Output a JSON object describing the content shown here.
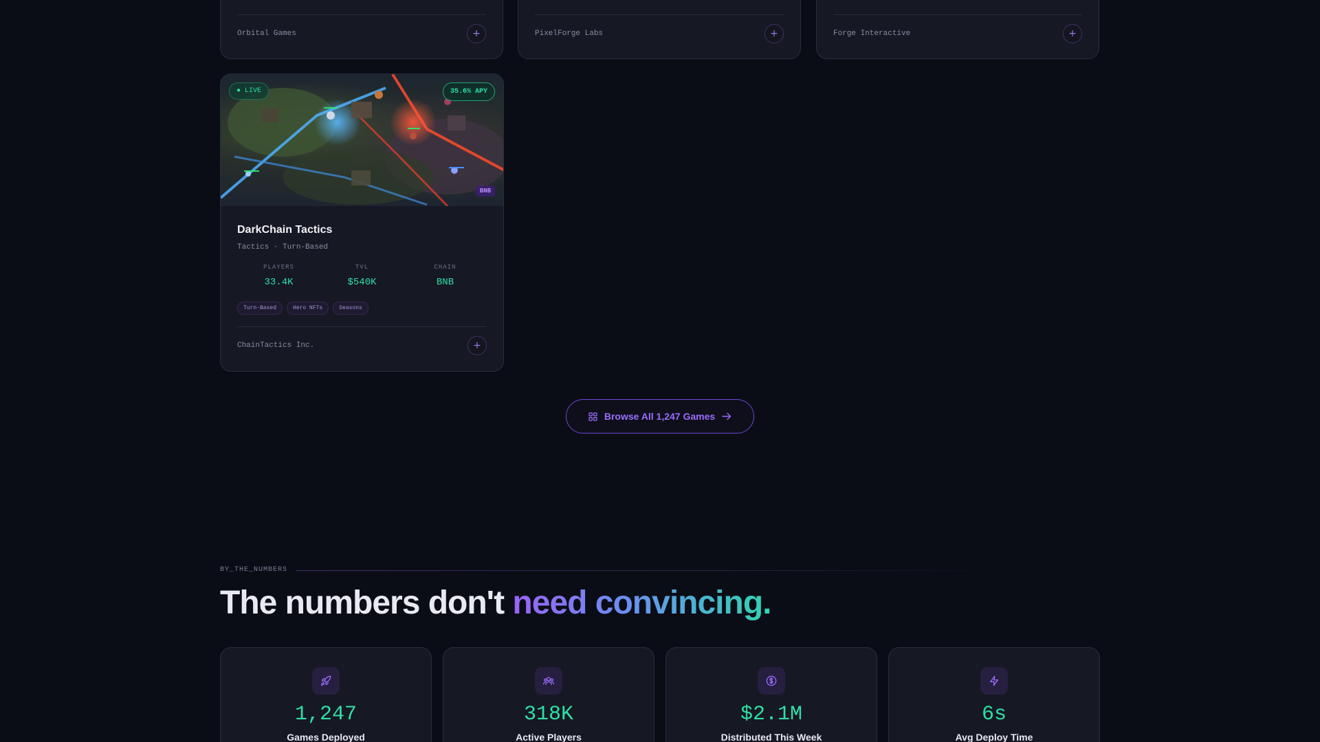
{
  "top_cards": [
    {
      "studio": "Orbital Games",
      "add_symbol": "+"
    },
    {
      "studio": "PixelForge Labs",
      "add_symbol": "+"
    },
    {
      "studio": "Forge Interactive",
      "add_symbol": "+"
    }
  ],
  "featured_game": {
    "status_badge": "● LIVE",
    "apy_badge": "35.6% APY",
    "chain_badge": "BNB",
    "title": "DarkChain Tactics",
    "genre": "Tactics · Turn-Based",
    "stats": [
      {
        "label": "PLAYERS",
        "value": "33.4K"
      },
      {
        "label": "TVL",
        "value": "$540K"
      },
      {
        "label": "CHAIN",
        "value": "BNB"
      }
    ],
    "tags": [
      "Turn-Based",
      "Hero NFTs",
      "Seasons"
    ],
    "studio": "ChainTactics Inc.",
    "add_symbol": "+"
  },
  "browse_button": {
    "label": "Browse All 1,247 Games",
    "icon_left": "grid-icon",
    "icon_right": "arrow-right-icon"
  },
  "numbers_section": {
    "eyebrow": "BY_THE_NUMBERS",
    "headline_plain": "The numbers don't ",
    "headline_accent": "need convincing.",
    "metrics": [
      {
        "icon": "rocket-icon",
        "value": "1,247",
        "label": "Games Deployed"
      },
      {
        "icon": "users-icon",
        "value": "318K",
        "label": "Active Players"
      },
      {
        "icon": "dollar-coin-icon",
        "value": "$2.1M",
        "label": "Distributed This Week"
      },
      {
        "icon": "lightning-icon",
        "value": "6s",
        "label": "Avg Deploy Time"
      }
    ]
  },
  "colors": {
    "background": "#0b0d16",
    "card": "#161823",
    "accent_green": "#2ee0a6",
    "accent_purple": "#9b6cff"
  }
}
